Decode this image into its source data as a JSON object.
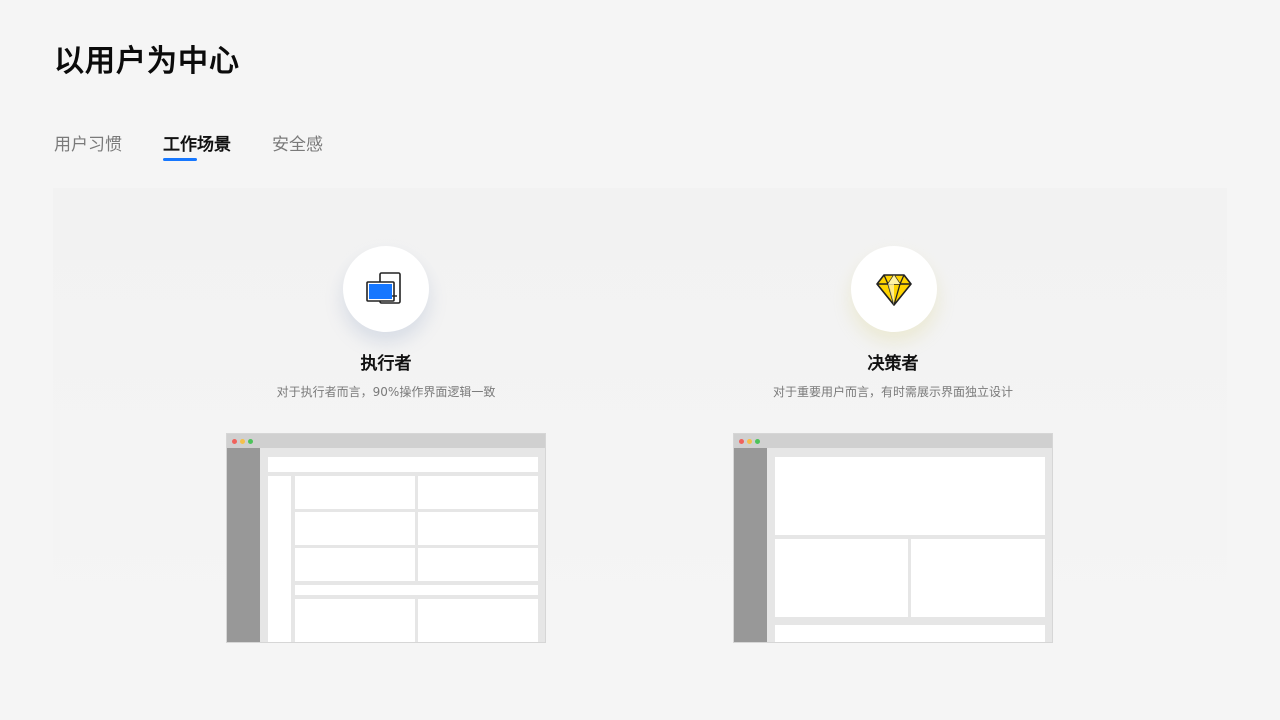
{
  "page": {
    "title": "以用户为中心"
  },
  "tabs": [
    {
      "label": "用户习惯",
      "active": false
    },
    {
      "label": "工作场景",
      "active": true
    },
    {
      "label": "安全感",
      "active": false
    }
  ],
  "cards": [
    {
      "title": "执行者",
      "description": "对于执行者而言，90%操作界面逻辑一致",
      "icon": "devices-icon"
    },
    {
      "title": "决策者",
      "description": "对于重要用户而言，有时需展示界面独立设计",
      "icon": "diamond-icon"
    }
  ],
  "colors": {
    "accent": "#1677ff",
    "diamond": "#ffd400",
    "window_close": "#f0625c",
    "window_minimize": "#f5c04a",
    "window_maximize": "#4cc35a"
  }
}
